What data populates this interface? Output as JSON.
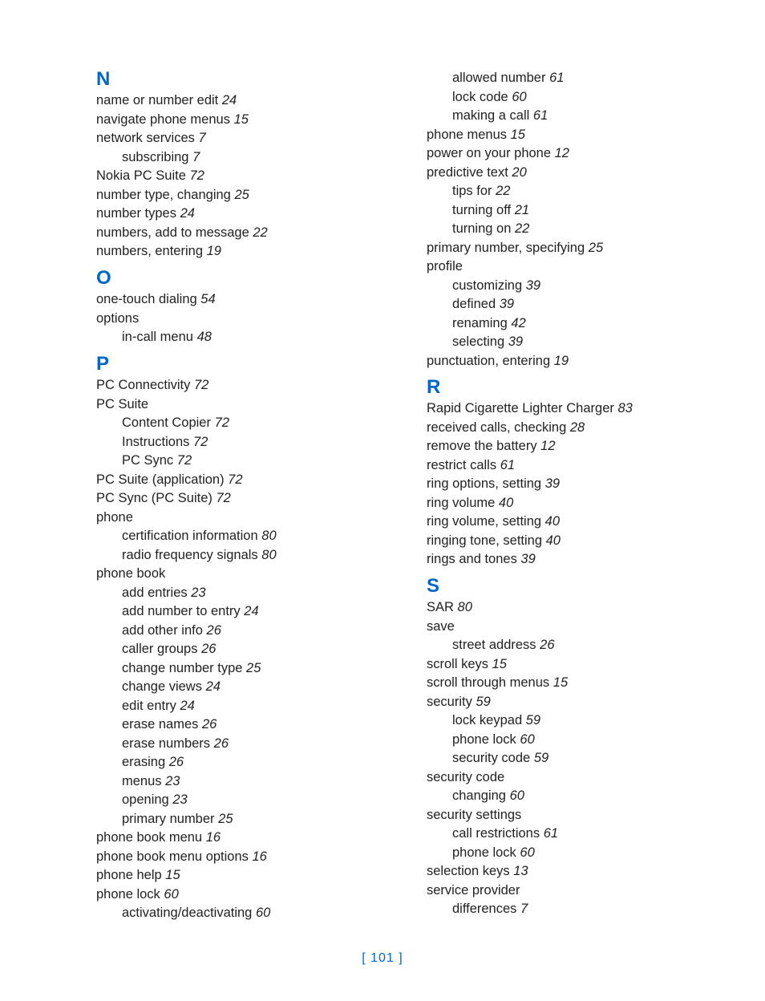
{
  "page_footer": "[ 101 ]",
  "left": [
    {
      "type": "letter",
      "text": "N"
    },
    {
      "type": "entry",
      "text": "name or number edit",
      "page": "24"
    },
    {
      "type": "entry",
      "text": "navigate phone menus",
      "page": "15"
    },
    {
      "type": "entry",
      "text": "network services",
      "page": "7"
    },
    {
      "type": "sub",
      "text": "subscribing",
      "page": "7"
    },
    {
      "type": "entry",
      "text": "Nokia PC Suite",
      "page": "72"
    },
    {
      "type": "entry",
      "text": "number type, changing",
      "page": "25"
    },
    {
      "type": "entry",
      "text": "number types",
      "page": "24"
    },
    {
      "type": "entry",
      "text": "numbers, add to message",
      "page": "22"
    },
    {
      "type": "entry",
      "text": "numbers, entering",
      "page": "19"
    },
    {
      "type": "letter",
      "text": "O"
    },
    {
      "type": "entry",
      "text": "one-touch dialing",
      "page": "54"
    },
    {
      "type": "entry",
      "text": "options"
    },
    {
      "type": "sub",
      "text": "in-call menu",
      "page": "48"
    },
    {
      "type": "letter",
      "text": "P"
    },
    {
      "type": "entry",
      "text": "PC Connectivity",
      "page": "72"
    },
    {
      "type": "entry",
      "text": "PC Suite"
    },
    {
      "type": "sub",
      "text": "Content Copier",
      "page": "72"
    },
    {
      "type": "sub",
      "text": "Instructions",
      "page": "72"
    },
    {
      "type": "sub",
      "text": "PC Sync",
      "page": "72"
    },
    {
      "type": "entry",
      "text": "PC Suite (application)",
      "page": "72"
    },
    {
      "type": "entry",
      "text": "PC Sync (PC Suite)",
      "page": "72"
    },
    {
      "type": "entry",
      "text": "phone"
    },
    {
      "type": "sub",
      "text": "certification information",
      "page": "80"
    },
    {
      "type": "sub",
      "text": "radio frequency signals",
      "page": "80"
    },
    {
      "type": "entry",
      "text": "phone book"
    },
    {
      "type": "sub",
      "text": "add entries",
      "page": "23"
    },
    {
      "type": "sub",
      "text": "add number to entry",
      "page": "24"
    },
    {
      "type": "sub",
      "text": "add other info",
      "page": "26"
    },
    {
      "type": "sub",
      "text": "caller groups",
      "page": "26"
    },
    {
      "type": "sub",
      "text": "change number type",
      "page": "25"
    },
    {
      "type": "sub",
      "text": "change views",
      "page": "24"
    },
    {
      "type": "sub",
      "text": "edit entry",
      "page": "24"
    },
    {
      "type": "sub",
      "text": "erase names",
      "page": "26"
    },
    {
      "type": "sub",
      "text": "erase numbers",
      "page": "26"
    },
    {
      "type": "sub",
      "text": "erasing",
      "page": "26"
    },
    {
      "type": "sub",
      "text": "menus",
      "page": "23"
    },
    {
      "type": "sub",
      "text": "opening",
      "page": "23"
    },
    {
      "type": "sub",
      "text": "primary number",
      "page": "25"
    },
    {
      "type": "entry",
      "text": "phone book menu",
      "page": "16"
    },
    {
      "type": "entry",
      "text": "phone book menu options",
      "page": "16"
    },
    {
      "type": "entry",
      "text": "phone help",
      "page": "15"
    },
    {
      "type": "entry",
      "text": "phone lock",
      "page": "60"
    },
    {
      "type": "sub",
      "text": "activating/deactivating",
      "page": "60"
    }
  ],
  "right": [
    {
      "type": "sub",
      "text": "allowed number",
      "page": "61"
    },
    {
      "type": "sub",
      "text": "lock code",
      "page": "60"
    },
    {
      "type": "sub",
      "text": "making a call",
      "page": "61"
    },
    {
      "type": "entry",
      "text": "phone menus",
      "page": "15"
    },
    {
      "type": "entry",
      "text": "power on your phone",
      "page": "12"
    },
    {
      "type": "entry",
      "text": "predictive text",
      "page": "20"
    },
    {
      "type": "sub",
      "text": "tips for",
      "page": "22"
    },
    {
      "type": "sub",
      "text": "turning off",
      "page": "21"
    },
    {
      "type": "sub",
      "text": "turning on",
      "page": "22"
    },
    {
      "type": "entry",
      "text": "primary number, specifying",
      "page": "25"
    },
    {
      "type": "entry",
      "text": "profile"
    },
    {
      "type": "sub",
      "text": "customizing",
      "page": "39"
    },
    {
      "type": "sub",
      "text": "defined",
      "page": "39"
    },
    {
      "type": "sub",
      "text": "renaming",
      "page": "42"
    },
    {
      "type": "sub",
      "text": "selecting",
      "page": "39"
    },
    {
      "type": "entry",
      "text": "punctuation, entering",
      "page": "19"
    },
    {
      "type": "letter",
      "text": "R"
    },
    {
      "type": "entry",
      "text": "Rapid Cigarette Lighter Charger",
      "page": "83"
    },
    {
      "type": "entry",
      "text": "received calls, checking",
      "page": "28"
    },
    {
      "type": "entry",
      "text": "remove the battery",
      "page": "12"
    },
    {
      "type": "entry",
      "text": "restrict calls",
      "page": "61"
    },
    {
      "type": "entry",
      "text": "ring options, setting",
      "page": "39"
    },
    {
      "type": "entry",
      "text": "ring volume",
      "page": "40"
    },
    {
      "type": "entry",
      "text": "ring volume, setting",
      "page": "40"
    },
    {
      "type": "entry",
      "text": "ringing tone, setting",
      "page": "40"
    },
    {
      "type": "entry",
      "text": "rings and tones",
      "page": "39"
    },
    {
      "type": "letter",
      "text": "S"
    },
    {
      "type": "entry",
      "text": "SAR",
      "page": "80"
    },
    {
      "type": "entry",
      "text": "save"
    },
    {
      "type": "sub",
      "text": "street address",
      "page": "26"
    },
    {
      "type": "entry",
      "text": "scroll keys",
      "page": "15"
    },
    {
      "type": "entry",
      "text": "scroll through menus",
      "page": "15"
    },
    {
      "type": "entry",
      "text": "security",
      "page": "59"
    },
    {
      "type": "sub",
      "text": "lock keypad",
      "page": "59"
    },
    {
      "type": "sub",
      "text": "phone lock",
      "page": "60"
    },
    {
      "type": "sub",
      "text": "security code",
      "page": "59"
    },
    {
      "type": "entry",
      "text": "security code"
    },
    {
      "type": "sub",
      "text": "changing",
      "page": "60"
    },
    {
      "type": "entry",
      "text": "security settings"
    },
    {
      "type": "sub",
      "text": "call restrictions",
      "page": "61"
    },
    {
      "type": "sub",
      "text": "phone lock",
      "page": "60"
    },
    {
      "type": "entry",
      "text": "selection keys",
      "page": "13"
    },
    {
      "type": "entry",
      "text": "service provider"
    },
    {
      "type": "sub",
      "text": "differences",
      "page": "7"
    }
  ]
}
